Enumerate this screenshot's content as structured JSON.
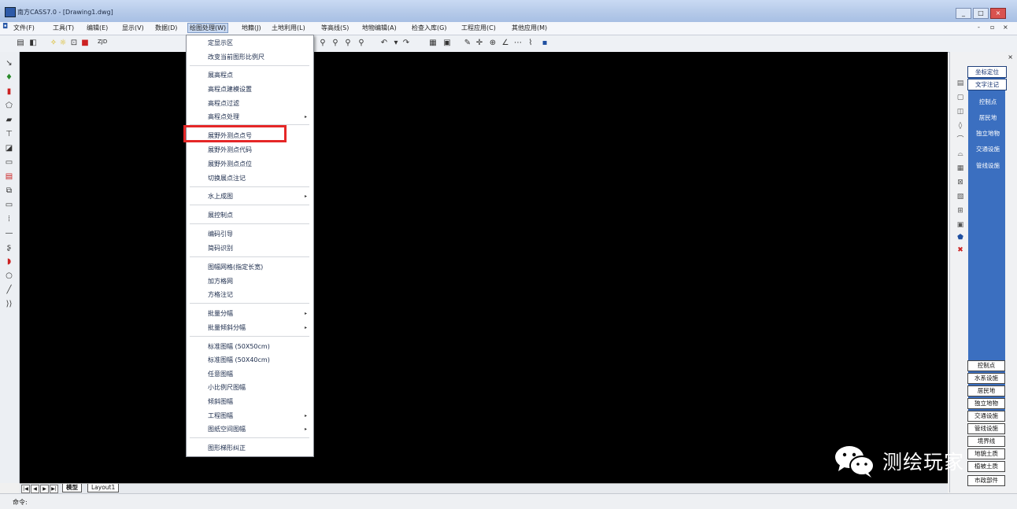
{
  "window": {
    "title": "南方CASS7.0 - [Drawing1.dwg]",
    "btn_min": "_",
    "btn_max": "□",
    "btn_close": "×"
  },
  "menubar": {
    "items": [
      "文件(F)",
      "工具(T)",
      "编辑(E)",
      "显示(V)",
      "数据(D)",
      "绘图处理(W)",
      "地籍(J)",
      "土地利用(L)",
      "等高线(S)",
      "地物编辑(A)",
      "检查入库(G)",
      "工程应用(C)",
      "其他应用(M)"
    ],
    "active_index": 5,
    "doc_controls": [
      "-",
      "▫",
      "×"
    ]
  },
  "toolbar": {
    "layer_value": "ZJD"
  },
  "dropdown": {
    "items": [
      {
        "label": "定显示区",
        "arrow": false
      },
      {
        "label": "改变当前图形比例尺",
        "arrow": false
      },
      {
        "label": "展高程点",
        "arrow": false
      },
      {
        "label": "高程点建模设置",
        "arrow": false
      },
      {
        "label": "高程点过滤",
        "arrow": false
      },
      {
        "label": "高程点处理",
        "arrow": true
      },
      {
        "label": "展野外测点点号",
        "arrow": false
      },
      {
        "label": "展野外测点代码",
        "arrow": false
      },
      {
        "label": "展野外测点点位",
        "arrow": false
      },
      {
        "label": "切换展点注记",
        "arrow": false
      },
      {
        "label": "水上成图",
        "arrow": true
      },
      {
        "label": "展控制点",
        "arrow": false
      },
      {
        "label": "编码引导",
        "arrow": false
      },
      {
        "label": "简码识别",
        "arrow": false
      },
      {
        "label": "图幅网格(指定长宽)",
        "arrow": false
      },
      {
        "label": "加方格网",
        "arrow": false
      },
      {
        "label": "方格注记",
        "arrow": false
      },
      {
        "label": "批量分幅",
        "arrow": true
      },
      {
        "label": "批量倾斜分幅",
        "arrow": true
      },
      {
        "label": "标准图幅 (50X50cm)",
        "arrow": false
      },
      {
        "label": "标准图幅 (50X40cm)",
        "arrow": false
      },
      {
        "label": "任意图幅",
        "arrow": false
      },
      {
        "label": "小比例尺图幅",
        "arrow": false
      },
      {
        "label": "倾斜图幅",
        "arrow": false
      },
      {
        "label": "工程图幅",
        "arrow": true
      },
      {
        "label": "图纸空间图幅",
        "arrow": true
      },
      {
        "label": "图形梯形纠正",
        "arrow": false
      }
    ],
    "highlighted_item": "展野外测点点号"
  },
  "right_panel": {
    "close": "×",
    "top_buttons": [
      "坐标定位",
      "文字注记"
    ],
    "categories": [
      "控制点",
      "居民地",
      "独立地物",
      "交通设施",
      "管线设施"
    ],
    "bottom_buttons": [
      "控制点",
      "水系设施",
      "居民地",
      "独立地物",
      "交通设施",
      "管线设施",
      "境界线",
      "地貌土质",
      "植被土质",
      "市政部件"
    ]
  },
  "tabs": {
    "nav": [
      "|◀",
      "◀",
      "▶",
      "▶|"
    ],
    "items": [
      "模型",
      "Layout1"
    ],
    "active": "模型"
  },
  "statusbar": {
    "prompt": "命令:"
  },
  "watermark": {
    "text": "测绘玩家"
  }
}
